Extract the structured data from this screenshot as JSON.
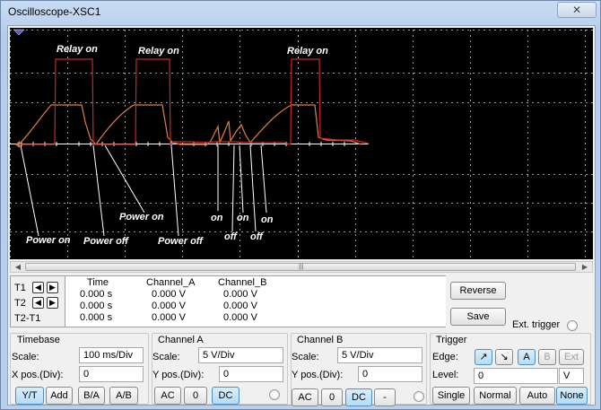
{
  "window": {
    "title": "Oscilloscope-XSC1",
    "close_glyph": "✕"
  },
  "annotations": {
    "relay_on_1": "Relay on",
    "relay_on_2": "Relay on",
    "relay_on_3": "Relay on",
    "power_on_1": "Power on",
    "power_off_1": "Power off",
    "power_on_2": "Power on",
    "power_off_2": "Power off",
    "on_1": "on",
    "on_2": "on",
    "on_3": "on",
    "off_1": "off",
    "off_2": "off"
  },
  "cursors": {
    "labels": [
      "T1",
      "T2",
      "T2-T1"
    ],
    "headers": {
      "time": "Time",
      "channel_a": "Channel_A",
      "channel_b": "Channel_B"
    },
    "rows": [
      {
        "time": "0.000 s",
        "a": "0.000 V",
        "b": "0.000 V"
      },
      {
        "time": "0.000 s",
        "a": "0.000 V",
        "b": "0.000 V"
      },
      {
        "time": "0.000 s",
        "a": "0.000 V",
        "b": "0.000 V"
      }
    ]
  },
  "actions": {
    "reverse": "Reverse",
    "save": "Save",
    "ext_trigger": "Ext. trigger"
  },
  "timebase": {
    "title": "Timebase",
    "scale_label": "Scale:",
    "scale": "100 ms/Div",
    "xpos_label": "X pos.(Div):",
    "xpos": "0",
    "modes": [
      "Y/T",
      "Add",
      "B/A",
      "A/B"
    ]
  },
  "channel_a": {
    "title": "Channel A",
    "scale_label": "Scale:",
    "scale": "5  V/Div",
    "ypos_label": "Y pos.(Div):",
    "ypos": "0",
    "coupling": [
      "AC",
      "0",
      "DC"
    ]
  },
  "channel_b": {
    "title": "Channel B",
    "scale_label": "Scale:",
    "scale": "5  V/Div",
    "ypos_label": "Y pos.(Div):",
    "ypos": "0",
    "coupling": [
      "AC",
      "0",
      "DC",
      "-"
    ]
  },
  "trigger": {
    "title": "Trigger",
    "edge_label": "Edge:",
    "edge_rise": "↗",
    "edge_fall": "↘",
    "sources": [
      "A",
      "B",
      "Ext"
    ],
    "level_label": "Level:",
    "level": "0",
    "level_unit": "V",
    "modes": [
      "Single",
      "Normal",
      "Auto",
      "None"
    ]
  },
  "colors": {
    "trace_a": "#e08040",
    "trace_b": "#c82828",
    "grid": "#9a9a9a",
    "screen": "#000000",
    "accent": "#4d8fc4"
  }
}
